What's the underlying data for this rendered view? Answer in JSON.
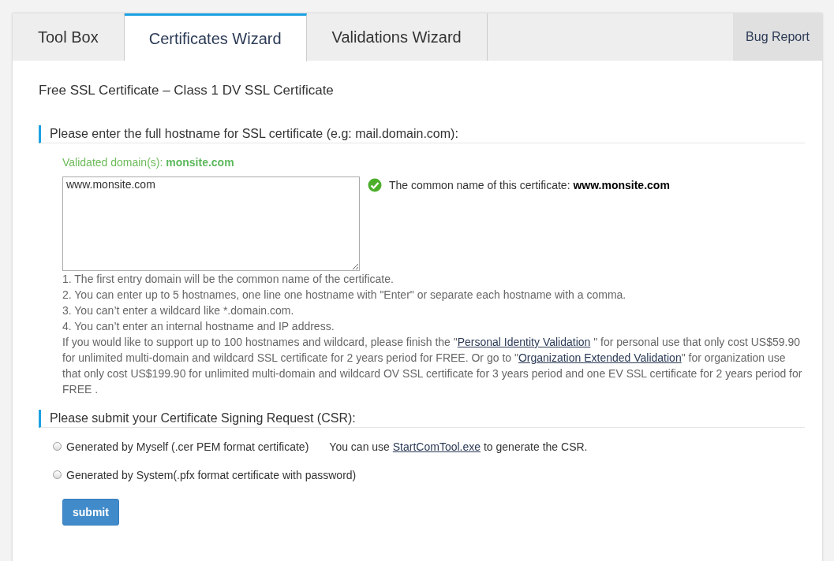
{
  "tabs": [
    {
      "label": "Tool Box",
      "selected": false
    },
    {
      "label": "Certificates Wizard",
      "selected": true
    },
    {
      "label": "Validations Wizard",
      "selected": false
    }
  ],
  "bug_report": "Bug Report",
  "title": "Free SSL Certificate – Class 1 DV SSL Certificate",
  "hostname_section": {
    "heading": "Please enter the full hostname for SSL certificate (e.g: mail.domain.com):",
    "validated": "Validated domain(s): **monsite.com**",
    "hostnames_value": "www.monsite.com",
    "common_name": "The common name of this certificate: **www.monsite.com**",
    "rules": [
      "1. The first entry domain will be the common name of the certificate.",
      "2. You can enter up to 5 hostnames, one line one hostname with \"Enter\" or separate each hostname with a comma.",
      "3. You can’t enter a wildcard like *.domain.com.",
      "4. You can’t enter an internal hostname and IP address."
    ],
    "upgrade_note": [
      {
        "kind": "text",
        "text": "If you would like to support up to 100 hostnames and wildcard, please finish the \""
      },
      {
        "kind": "link",
        "text": "Personal Identity Validation"
      },
      {
        "kind": "text",
        "text": " \" for personal use that only cost US$59.90 for unlimited multi-domain and wildcard SSL certificate for 2 years period for FREE. Or go to \""
      },
      {
        "kind": "link",
        "text": "Organization Extended Validation"
      },
      {
        "kind": "text",
        "text": "\" for organization use that only cost US$199.90 for unlimited multi-domain and wildcard OV SSL certificate for 3 years period and one EV SSL certificate for 2 years period for FREE ."
      }
    ]
  },
  "csr_section": {
    "heading": "Please submit your Certificate Signing Request (CSR):",
    "options": [
      {
        "label": "Generated by Myself (.cer PEM format certificate)",
        "selected": false,
        "hint": [
          {
            "kind": "text",
            "text": "You can use "
          },
          {
            "kind": "link",
            "text": "StartComTool.exe"
          },
          {
            "kind": "text",
            "text": " to generate the CSR."
          }
        ]
      },
      {
        "label": "Generated by System(.pfx format certificate with password)",
        "selected": false
      }
    ],
    "submit": "submit"
  }
}
